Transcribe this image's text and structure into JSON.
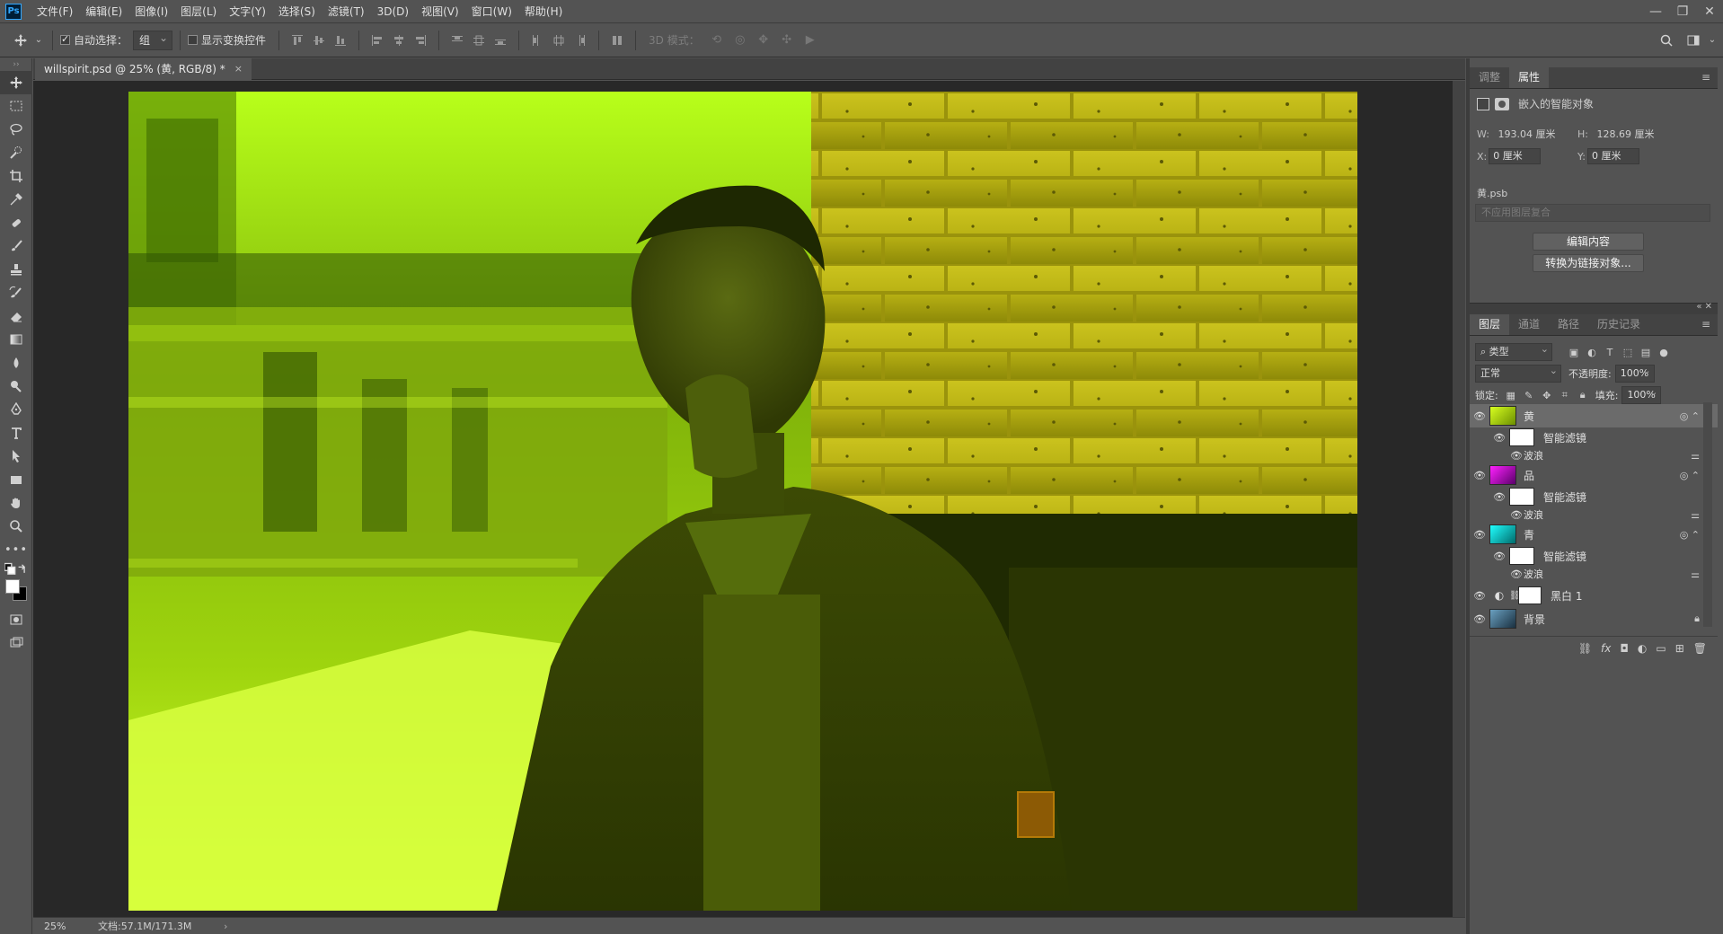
{
  "menubar": {
    "logo": "Ps",
    "items": [
      "文件(F)",
      "编辑(E)",
      "图像(I)",
      "图层(L)",
      "文字(Y)",
      "选择(S)",
      "滤镜(T)",
      "3D(D)",
      "视图(V)",
      "窗口(W)",
      "帮助(H)"
    ],
    "controls": [
      "—",
      "❐",
      "✕"
    ]
  },
  "options": {
    "auto_select_label": "自动选择：",
    "auto_select_checked": true,
    "auto_select_value": "组",
    "show_transform_label": "显示变换控件",
    "mode_3d_label": "3D 模式："
  },
  "document": {
    "tab_title": "willspirit.psd @ 25% (黄, RGB/8) *",
    "tab_close": "×",
    "zoom": "25%",
    "doc_info": "文档:57.1M/171.3M",
    "arrow": "›"
  },
  "properties": {
    "tabs": [
      "调整",
      "属性"
    ],
    "active_tab": "属性",
    "object_type": "嵌入的智能对象",
    "w_label": "W:",
    "w_value": "193.04 厘米",
    "h_label": "H:",
    "h_value": "128.69 厘米",
    "x_label": "X:",
    "x_value": "0 厘米",
    "y_label": "Y:",
    "y_value": "0 厘米",
    "file_name": "黄.psb",
    "comp_placeholder": "不应用图层复合",
    "edit_button": "编辑内容",
    "convert_button": "转换为链接对象..."
  },
  "layers_panel": {
    "tabs": [
      "图层",
      "通道",
      "路径",
      "历史记录"
    ],
    "active_tab": "图层",
    "filter_kind": "类型",
    "blend_mode": "正常",
    "opacity_label": "不透明度:",
    "opacity_value": "100%",
    "lock_label": "锁定:",
    "fill_label": "填充:",
    "fill_value": "100%",
    "layers": [
      {
        "name": "黄",
        "type": "smart",
        "selected": true,
        "thumb": "yellow"
      },
      {
        "name": "智能滤镜",
        "type": "filter-mask"
      },
      {
        "name": "波浪",
        "type": "filter"
      },
      {
        "name": "品",
        "type": "smart",
        "selected": false,
        "thumb": "magenta"
      },
      {
        "name": "智能滤镜",
        "type": "filter-mask"
      },
      {
        "name": "波浪",
        "type": "filter"
      },
      {
        "name": "青",
        "type": "smart",
        "selected": false,
        "thumb": "cyan"
      },
      {
        "name": "智能滤镜",
        "type": "filter-mask"
      },
      {
        "name": "波浪",
        "type": "filter"
      },
      {
        "name": "黑白 1",
        "type": "adjustment"
      },
      {
        "name": "背景",
        "type": "background",
        "thumb": "photo"
      }
    ]
  },
  "colors": {
    "ui_bg": "#535353",
    "canvas_bg": "#282828",
    "accent": "#31a8ff",
    "image_tint": "#c8e600"
  }
}
